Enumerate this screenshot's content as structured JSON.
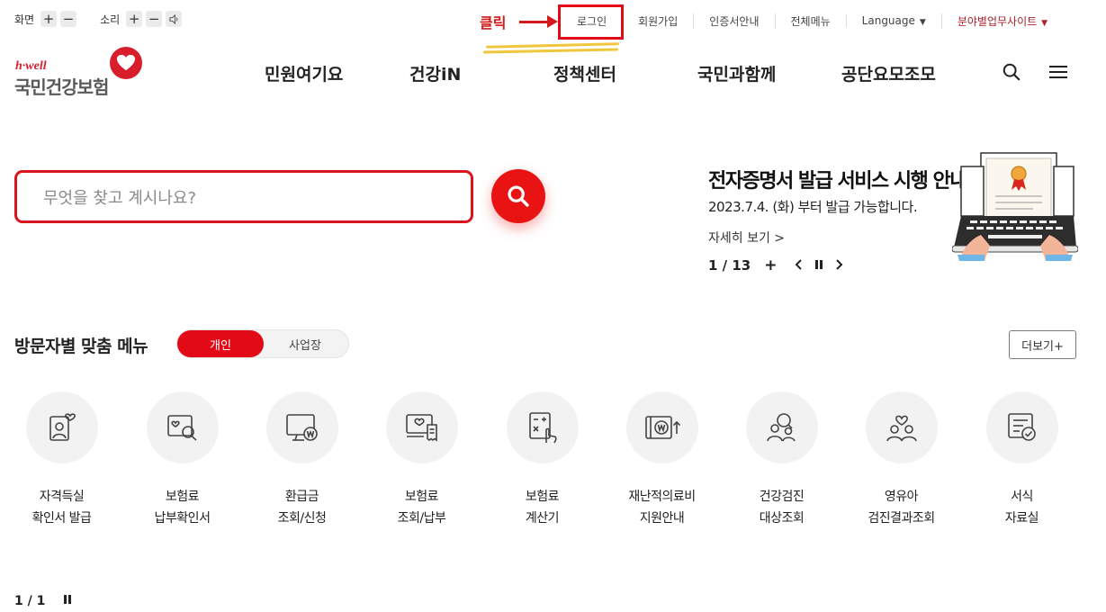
{
  "utility": {
    "screen_label": "화면",
    "sound_label": "소리",
    "plus": "+",
    "minus": "−",
    "links": [
      "로그인",
      "회원가입",
      "인증서안내",
      "전체메뉴",
      "Language",
      "분야별업무사이트"
    ]
  },
  "annotation": {
    "click_label": "클릭",
    "highlight_color": "#e30a17"
  },
  "logo": {
    "tagline": "h·well",
    "name": "국민건강보험"
  },
  "nav": {
    "items": [
      "민원여기요",
      "건강iN",
      "정책센터",
      "국민과함께",
      "공단요모조모"
    ]
  },
  "search": {
    "placeholder": "무엇을 찾고 계시나요?"
  },
  "banner": {
    "title": "전자증명서 발급 서비스 시행 안내",
    "subtitle": "2023.7.4. (화) 부터 발급 가능합니다.",
    "more": "자세히 보기 >",
    "counter": "1 / 13"
  },
  "custom_menu": {
    "title": "방문자별 맞춤 메뉴",
    "toggle_on": "개인",
    "toggle_off": "사업장",
    "more": "더보기+",
    "items": [
      {
        "line1": "자격득실",
        "line2": "확인서 발급",
        "icon": "id-card-heart-icon"
      },
      {
        "line1": "보험료",
        "line2": "납부확인서",
        "icon": "document-search-icon"
      },
      {
        "line1": "환급금",
        "line2": "조회/신청",
        "icon": "monitor-won-icon"
      },
      {
        "line1": "보험료",
        "line2": "조회/납부",
        "icon": "screen-receipt-icon"
      },
      {
        "line1": "보험료",
        "line2": "계산기",
        "icon": "calculator-icon"
      },
      {
        "line1": "재난적의료비",
        "line2": "지원안내",
        "icon": "won-wallet-icon"
      },
      {
        "line1": "건강검진",
        "line2": "대상조회",
        "icon": "people-search-icon"
      },
      {
        "line1": "영유아",
        "line2": "검진결과조회",
        "icon": "family-heart-icon"
      },
      {
        "line1": "서식",
        "line2": "자료실",
        "icon": "form-check-icon"
      }
    ],
    "pager": "1 / 1"
  },
  "colors": {
    "brand_red": "#e30a17",
    "logo_red": "#d81e2d",
    "underline_yellow": "#f0c63c"
  }
}
